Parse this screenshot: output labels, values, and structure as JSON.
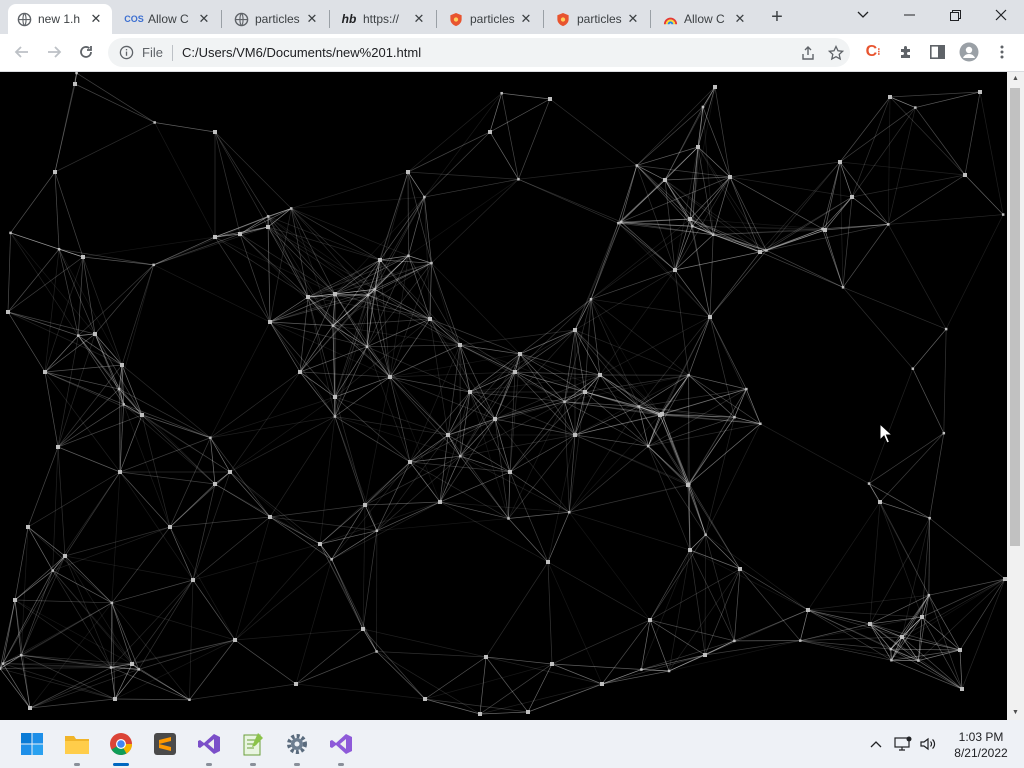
{
  "browser": {
    "tabs": [
      {
        "title": "new 1.h",
        "icon": "globe-icon",
        "active": true
      },
      {
        "title": "Allow C",
        "icon": "cos-logo-icon",
        "active": false
      },
      {
        "title": "particles",
        "icon": "globe-icon",
        "active": false
      },
      {
        "title": "https://",
        "icon": "hb-logo-icon",
        "active": false
      },
      {
        "title": "particles",
        "icon": "shield-logo-icon",
        "active": false
      },
      {
        "title": "particles",
        "icon": "shield-logo-icon",
        "active": false
      },
      {
        "title": "Allow C",
        "icon": "rainbow-logo-icon",
        "active": false
      }
    ],
    "new_tab_label": "+",
    "omnibox": {
      "scheme_label": "File",
      "url": "C:/Users/VM6/Documents/new%201.html"
    }
  },
  "taskbar": {
    "apps": [
      {
        "name": "start",
        "icon": "windows-start-icon"
      },
      {
        "name": "file-explorer",
        "icon": "folder-icon"
      },
      {
        "name": "chrome",
        "icon": "chrome-icon",
        "active": true
      },
      {
        "name": "sublime-text",
        "icon": "sublime-icon"
      },
      {
        "name": "visual-studio-1",
        "icon": "visual-studio-icon"
      },
      {
        "name": "notepad-plus-plus",
        "icon": "notepad-icon"
      },
      {
        "name": "settings",
        "icon": "gear-icon"
      },
      {
        "name": "visual-studio-2",
        "icon": "visual-studio-icon"
      }
    ],
    "clock": {
      "time": "1:03 PM",
      "date": "8/21/2022"
    }
  },
  "colors": {
    "page_background": "#000000",
    "particle_color": "#ffffff",
    "tabstrip": "#dee1e6",
    "taskbar": "#eef1f6",
    "accent": "#0067c0"
  }
}
